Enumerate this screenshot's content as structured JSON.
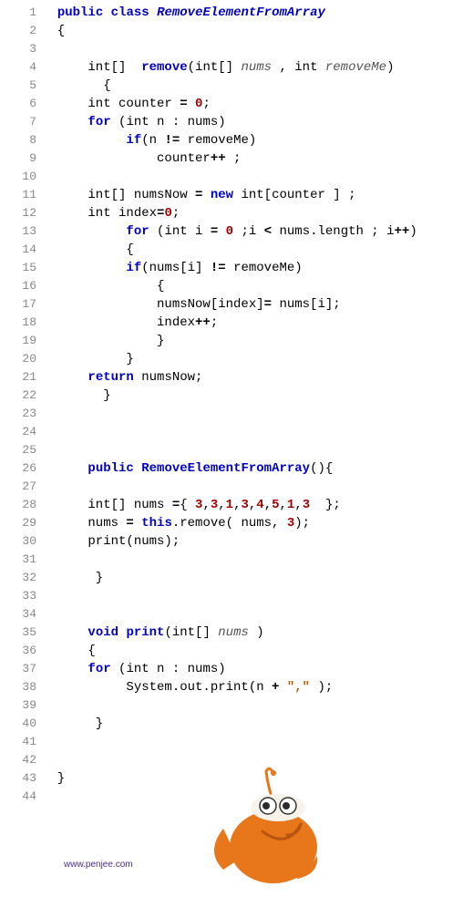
{
  "footer": {
    "url": "www.penjee.com"
  },
  "code_style": {
    "font": "Consolas",
    "line_height_px": 20
  },
  "lines": [
    {
      "n": 1,
      "tokens": [
        {
          "t": "  "
        },
        {
          "t": "public",
          "c": "kw"
        },
        {
          "t": " "
        },
        {
          "t": "class",
          "c": "kw"
        },
        {
          "t": " "
        },
        {
          "t": "RemoveElementFromArray",
          "c": "cls"
        }
      ]
    },
    {
      "n": 2,
      "tokens": [
        {
          "t": "  {"
        }
      ]
    },
    {
      "n": 3,
      "tokens": [
        {
          "t": " "
        }
      ]
    },
    {
      "n": 4,
      "tokens": [
        {
          "t": "      int[]  "
        },
        {
          "t": "remove",
          "c": "method"
        },
        {
          "t": "(int[] "
        },
        {
          "t": "nums",
          "c": "param"
        },
        {
          "t": " , int "
        },
        {
          "t": "removeMe",
          "c": "param"
        },
        {
          "t": ")"
        }
      ]
    },
    {
      "n": 5,
      "tokens": [
        {
          "t": "        {"
        }
      ]
    },
    {
      "n": 6,
      "tokens": [
        {
          "t": "      int counter "
        },
        {
          "t": "=",
          "c": "op"
        },
        {
          "t": " "
        },
        {
          "t": "0",
          "c": "num"
        },
        {
          "t": ";"
        }
      ]
    },
    {
      "n": 7,
      "tokens": [
        {
          "t": "      "
        },
        {
          "t": "for",
          "c": "kw"
        },
        {
          "t": " (int n : nums)"
        }
      ]
    },
    {
      "n": 8,
      "tokens": [
        {
          "t": "           "
        },
        {
          "t": "if",
          "c": "kw"
        },
        {
          "t": "(n "
        },
        {
          "t": "!=",
          "c": "op"
        },
        {
          "t": " removeMe)"
        }
      ]
    },
    {
      "n": 9,
      "tokens": [
        {
          "t": "               counter"
        },
        {
          "t": "++",
          "c": "op"
        },
        {
          "t": " ;"
        }
      ]
    },
    {
      "n": 10,
      "tokens": [
        {
          "t": " "
        }
      ]
    },
    {
      "n": 11,
      "tokens": [
        {
          "t": "      int[] numsNow "
        },
        {
          "t": "=",
          "c": "op"
        },
        {
          "t": " "
        },
        {
          "t": "new",
          "c": "kw"
        },
        {
          "t": " int[counter ] ;"
        }
      ]
    },
    {
      "n": 12,
      "tokens": [
        {
          "t": "      int index"
        },
        {
          "t": "=",
          "c": "op"
        },
        {
          "t": "0",
          "c": "num"
        },
        {
          "t": ";"
        }
      ]
    },
    {
      "n": 13,
      "tokens": [
        {
          "t": "           "
        },
        {
          "t": "for",
          "c": "kw"
        },
        {
          "t": " (int i "
        },
        {
          "t": "=",
          "c": "op"
        },
        {
          "t": " "
        },
        {
          "t": "0",
          "c": "num"
        },
        {
          "t": " ;i "
        },
        {
          "t": "<",
          "c": "op"
        },
        {
          "t": " nums.length ; i"
        },
        {
          "t": "++",
          "c": "op"
        },
        {
          "t": ")"
        }
      ]
    },
    {
      "n": 14,
      "tokens": [
        {
          "t": "           {"
        }
      ]
    },
    {
      "n": 15,
      "tokens": [
        {
          "t": "           "
        },
        {
          "t": "if",
          "c": "kw"
        },
        {
          "t": "(nums[i] "
        },
        {
          "t": "!=",
          "c": "op"
        },
        {
          "t": " removeMe)"
        }
      ]
    },
    {
      "n": 16,
      "tokens": [
        {
          "t": "               {"
        }
      ]
    },
    {
      "n": 17,
      "tokens": [
        {
          "t": "               numsNow[index]"
        },
        {
          "t": "=",
          "c": "op"
        },
        {
          "t": " nums[i];"
        }
      ]
    },
    {
      "n": 18,
      "tokens": [
        {
          "t": "               index"
        },
        {
          "t": "++",
          "c": "op"
        },
        {
          "t": ";"
        }
      ]
    },
    {
      "n": 19,
      "tokens": [
        {
          "t": "               }"
        }
      ]
    },
    {
      "n": 20,
      "tokens": [
        {
          "t": "           }"
        }
      ]
    },
    {
      "n": 21,
      "tokens": [
        {
          "t": "      "
        },
        {
          "t": "return",
          "c": "kw"
        },
        {
          "t": " numsNow;"
        }
      ]
    },
    {
      "n": 22,
      "tokens": [
        {
          "t": "        }"
        }
      ]
    },
    {
      "n": 23,
      "tokens": [
        {
          "t": " "
        }
      ]
    },
    {
      "n": 24,
      "tokens": [
        {
          "t": " "
        }
      ]
    },
    {
      "n": 25,
      "tokens": [
        {
          "t": " "
        }
      ]
    },
    {
      "n": 26,
      "tokens": [
        {
          "t": "      "
        },
        {
          "t": "public",
          "c": "kw"
        },
        {
          "t": " "
        },
        {
          "t": "RemoveElementFromArray",
          "c": "method"
        },
        {
          "t": "(){"
        }
      ]
    },
    {
      "n": 27,
      "tokens": [
        {
          "t": " "
        }
      ]
    },
    {
      "n": 28,
      "tokens": [
        {
          "t": "      int[] nums "
        },
        {
          "t": "=",
          "c": "op"
        },
        {
          "t": "{ "
        },
        {
          "t": "3",
          "c": "num"
        },
        {
          "t": ","
        },
        {
          "t": "3",
          "c": "num"
        },
        {
          "t": ","
        },
        {
          "t": "1",
          "c": "num"
        },
        {
          "t": ","
        },
        {
          "t": "3",
          "c": "num"
        },
        {
          "t": ","
        },
        {
          "t": "4",
          "c": "num"
        },
        {
          "t": ","
        },
        {
          "t": "5",
          "c": "num"
        },
        {
          "t": ","
        },
        {
          "t": "1",
          "c": "num"
        },
        {
          "t": ","
        },
        {
          "t": "3",
          "c": "num"
        },
        {
          "t": "  };"
        }
      ]
    },
    {
      "n": 29,
      "tokens": [
        {
          "t": "      nums "
        },
        {
          "t": "=",
          "c": "op"
        },
        {
          "t": " "
        },
        {
          "t": "this",
          "c": "kw"
        },
        {
          "t": ".remove( nums, "
        },
        {
          "t": "3",
          "c": "num"
        },
        {
          "t": ");"
        }
      ]
    },
    {
      "n": 30,
      "tokens": [
        {
          "t": "      print(nums);"
        }
      ]
    },
    {
      "n": 31,
      "tokens": [
        {
          "t": " "
        }
      ]
    },
    {
      "n": 32,
      "tokens": [
        {
          "t": "       }"
        }
      ]
    },
    {
      "n": 33,
      "tokens": [
        {
          "t": " "
        }
      ]
    },
    {
      "n": 34,
      "tokens": [
        {
          "t": " "
        }
      ]
    },
    {
      "n": 35,
      "tokens": [
        {
          "t": "      "
        },
        {
          "t": "void",
          "c": "kw"
        },
        {
          "t": " "
        },
        {
          "t": "print",
          "c": "method"
        },
        {
          "t": "(int[] "
        },
        {
          "t": "nums",
          "c": "param"
        },
        {
          "t": " )"
        }
      ]
    },
    {
      "n": 36,
      "tokens": [
        {
          "t": "      {"
        }
      ]
    },
    {
      "n": 37,
      "tokens": [
        {
          "t": "      "
        },
        {
          "t": "for",
          "c": "kw"
        },
        {
          "t": " (int n : nums)"
        }
      ]
    },
    {
      "n": 38,
      "tokens": [
        {
          "t": "           System.out.print(n "
        },
        {
          "t": "+",
          "c": "op"
        },
        {
          "t": " "
        },
        {
          "t": "\",\"",
          "c": "str"
        },
        {
          "t": " );"
        }
      ]
    },
    {
      "n": 39,
      "tokens": [
        {
          "t": " "
        }
      ]
    },
    {
      "n": 40,
      "tokens": [
        {
          "t": "       }"
        }
      ]
    },
    {
      "n": 41,
      "tokens": [
        {
          "t": " "
        }
      ]
    },
    {
      "n": 42,
      "tokens": [
        {
          "t": " "
        }
      ]
    },
    {
      "n": 43,
      "tokens": [
        {
          "t": "  }"
        }
      ]
    },
    {
      "n": 44,
      "tokens": [
        {
          "t": " "
        }
      ]
    }
  ]
}
